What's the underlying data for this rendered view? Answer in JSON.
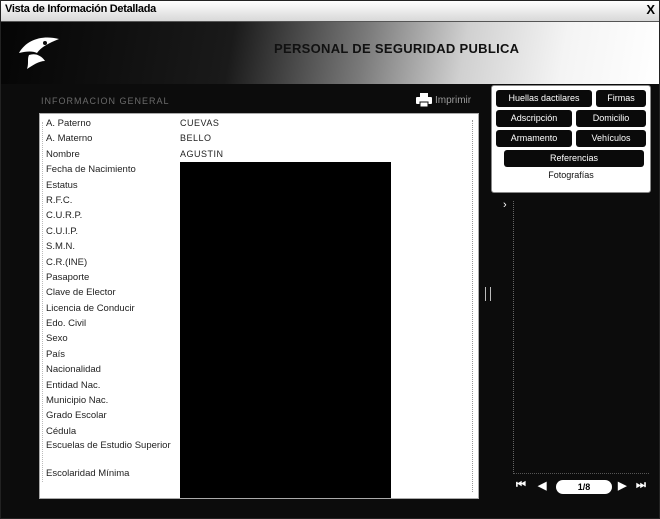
{
  "window": {
    "title": "Vista de Información Detallada",
    "close_label": "X"
  },
  "banner": {
    "title": "PERSONAL DE SEGURIDAD PUBLICA"
  },
  "section_label": "INFORMACION GENERAL",
  "print_label": "Imprimir",
  "fields": [
    {
      "label": "A. Paterno",
      "value": "CUEVAS"
    },
    {
      "label": "A. Materno",
      "value": "BELLO"
    },
    {
      "label": "Nombre",
      "value": "AGUSTIN"
    },
    {
      "label": "Fecha de Nacimiento",
      "value": ""
    },
    {
      "label": "Estatus",
      "value": ""
    },
    {
      "label": "R.F.C.",
      "value": ""
    },
    {
      "label": "C.U.R.P.",
      "value": ""
    },
    {
      "label": "C.U.I.P.",
      "value": ""
    },
    {
      "label": "S.M.N.",
      "value": ""
    },
    {
      "label": "C.R.(INE)",
      "value": ""
    },
    {
      "label": "Pasaporte",
      "value": ""
    },
    {
      "label": "Clave de Elector",
      "value": ""
    },
    {
      "label": "Licencia de Conducir",
      "value": ""
    },
    {
      "label": "Edo. Civil",
      "value": ""
    },
    {
      "label": "Sexo",
      "value": ""
    },
    {
      "label": "País",
      "value": ""
    },
    {
      "label": "Nacionalidad",
      "value": ""
    },
    {
      "label": "Entidad Nac.",
      "value": ""
    },
    {
      "label": "Municipio Nac.",
      "value": ""
    },
    {
      "label": "Grado Escolar",
      "value": ""
    },
    {
      "label": "Cédula",
      "value": ""
    },
    {
      "label": "Escuelas de Estudio Superior",
      "value": ""
    },
    {
      "label": "Escolaridad Mínima",
      "value": ""
    }
  ],
  "side_buttons": {
    "huellas": "Huellas dactilares",
    "firmas": "Firmas",
    "adscripcion": "Adscripción",
    "domicilio": "Domicilio",
    "armamento": "Armamento",
    "vehiculos": "Vehículos",
    "referencias": "Referencias",
    "fotografias": "Fotografías"
  },
  "photo_nav": {
    "page": "1/8",
    "first": "⏮",
    "prev": "◀",
    "next": "▶",
    "last": "⏭"
  },
  "colors": {
    "background": "#0c0c0c",
    "panel": "#ffffff",
    "button": "#0a0a0a"
  },
  "icons": {
    "logo": "eagle-logo-icon",
    "print": "printer-icon",
    "expand": "chevron-right-icon"
  }
}
